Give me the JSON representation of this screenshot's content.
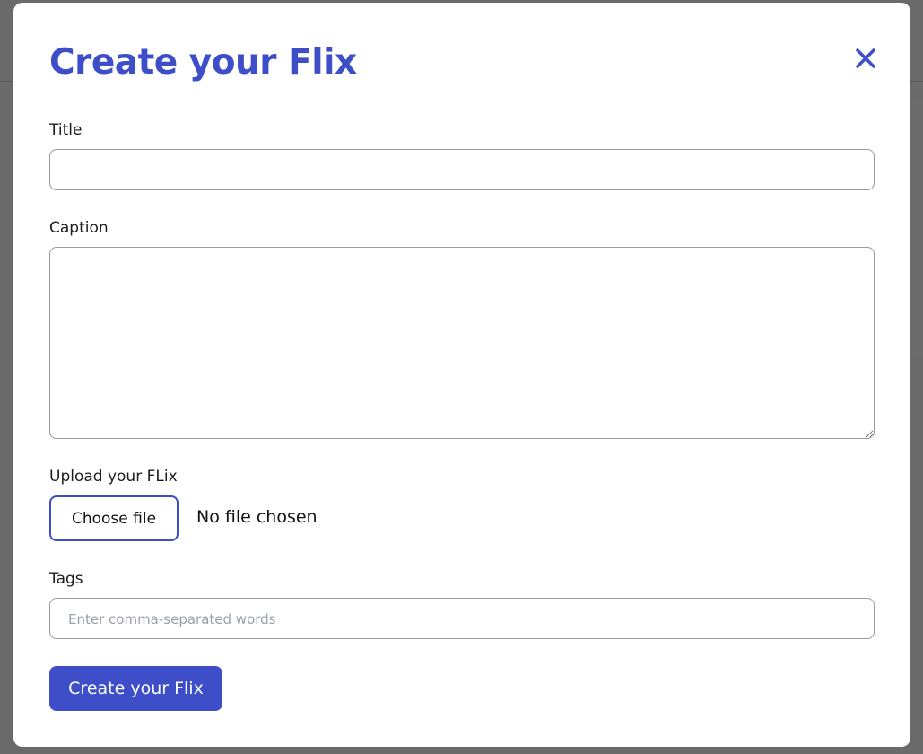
{
  "modal": {
    "title": "Create your Flix",
    "close_icon": "close-icon"
  },
  "form": {
    "title_label": "Title",
    "title_value": "",
    "caption_label": "Caption",
    "caption_value": "",
    "upload_label": "Upload your FLix",
    "choose_file_label": "Choose file",
    "file_status": "No file chosen",
    "tags_label": "Tags",
    "tags_placeholder": "Enter comma-separated words",
    "tags_value": "",
    "submit_label": "Create your Flix"
  },
  "colors": {
    "accent": "#3d4ec8",
    "overlay": "#5f5f5f",
    "modal_bg": "#ffffff"
  }
}
